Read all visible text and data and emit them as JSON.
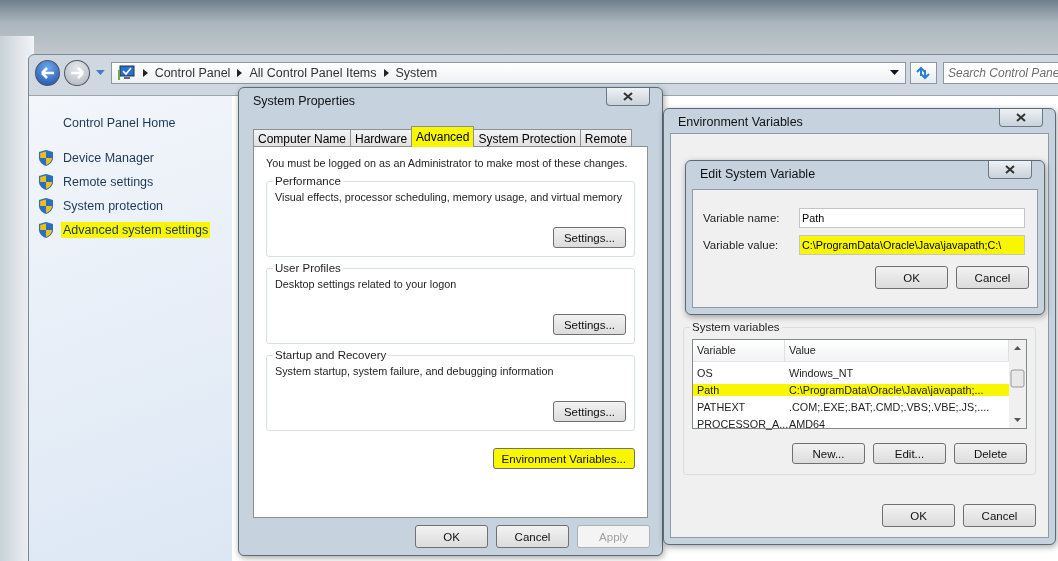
{
  "explorer": {
    "breadcrumb": [
      "Control Panel",
      "All Control Panel Items",
      "System"
    ],
    "search": {
      "placeholder": "Search Control Pane"
    }
  },
  "sidebar": {
    "home": "Control Panel Home",
    "items": [
      {
        "label": "Device Manager",
        "highlighted": false
      },
      {
        "label": "Remote settings",
        "highlighted": false
      },
      {
        "label": "System protection",
        "highlighted": false
      },
      {
        "label": "Advanced system settings",
        "highlighted": true
      }
    ]
  },
  "system_properties": {
    "title": "System Properties",
    "tabs": [
      {
        "label": "Computer Name",
        "selected": false,
        "highlighted": false
      },
      {
        "label": "Hardware",
        "selected": false,
        "highlighted": false
      },
      {
        "label": "Advanced",
        "selected": true,
        "highlighted": true
      },
      {
        "label": "System Protection",
        "selected": false,
        "highlighted": false
      },
      {
        "label": "Remote",
        "selected": false,
        "highlighted": false
      }
    ],
    "notice": "You must be logged on as an Administrator to make most of these changes.",
    "groups": [
      {
        "title": "Performance",
        "text": "Visual effects, processor scheduling, memory usage, and virtual memory",
        "button": "Settings..."
      },
      {
        "title": "User Profiles",
        "text": "Desktop settings related to your logon",
        "button": "Settings..."
      },
      {
        "title": "Startup and Recovery",
        "text": "System startup, system failure, and debugging information",
        "button": "Settings..."
      }
    ],
    "env_button": {
      "label": "Environment Variables...",
      "highlighted": true
    },
    "buttons": [
      {
        "label": "OK",
        "disabled": false
      },
      {
        "label": "Cancel",
        "disabled": false
      },
      {
        "label": "Apply",
        "disabled": true
      }
    ]
  },
  "environment_variables": {
    "title": "Environment Variables",
    "system_variables": {
      "title": "System variables",
      "columns": [
        "Variable",
        "Value"
      ],
      "rows": [
        {
          "variable": "OS",
          "value": "Windows_NT",
          "highlighted": false
        },
        {
          "variable": "Path",
          "value": "C:\\ProgramData\\Oracle\\Java\\javapath;...",
          "highlighted": true
        },
        {
          "variable": "PATHEXT",
          "value": ".COM;.EXE;.BAT;.CMD;.VBS;.VBE;.JS;....",
          "highlighted": false
        },
        {
          "variable": "PROCESSOR_A...",
          "value": "AMD64",
          "highlighted": false
        }
      ]
    },
    "actions": [
      "New...",
      "Edit...",
      "Delete"
    ],
    "buttons": [
      "OK",
      "Cancel"
    ]
  },
  "edit_dialog": {
    "title": "Edit System Variable",
    "fields": [
      {
        "label": "Variable name:",
        "value": "Path",
        "highlighted": false
      },
      {
        "label": "Variable value:",
        "value": "C:\\ProgramData\\Oracle\\Java\\javapath;C:\\",
        "highlighted": true
      }
    ],
    "buttons": [
      "OK",
      "Cancel"
    ]
  }
}
